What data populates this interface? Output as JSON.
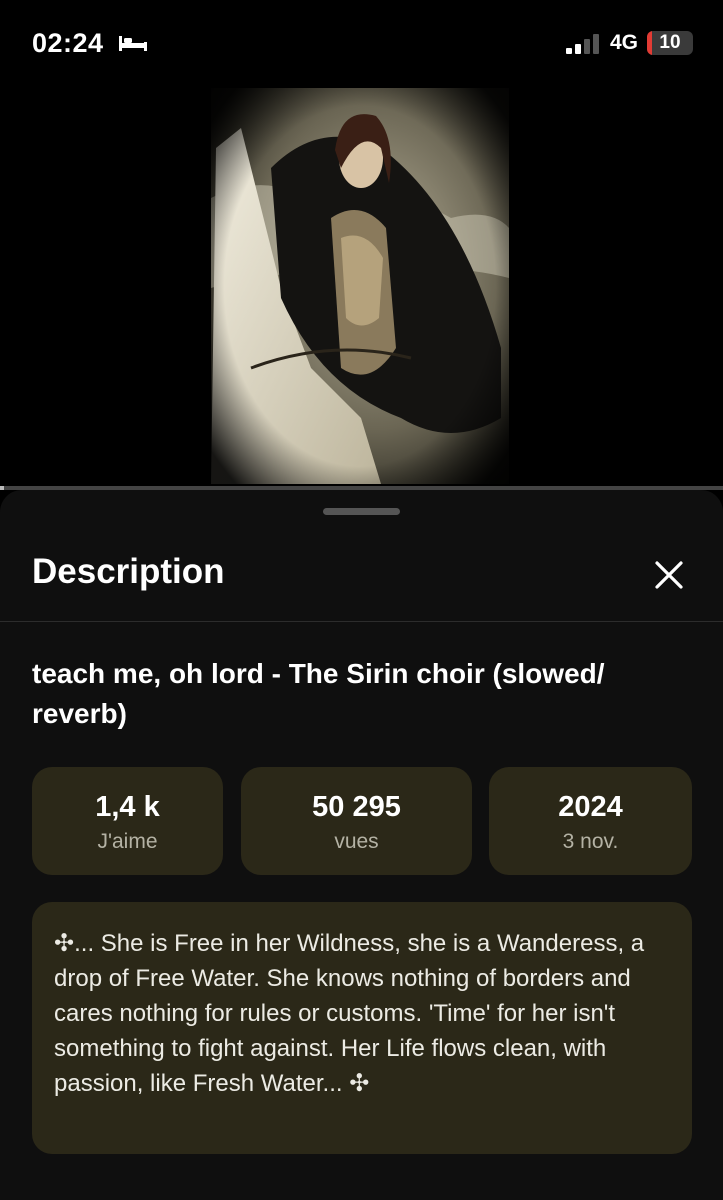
{
  "status_bar": {
    "time": "02:24",
    "network": "4G",
    "battery_level": "10",
    "battery_fraction": 0.1,
    "bed_icon": "bed-icon",
    "signal_icon": "signal-icon",
    "battery_color": "#e23b34"
  },
  "video": {
    "progress_fraction": 0.005
  },
  "sheet": {
    "title": "Description",
    "close_icon": "close-icon",
    "video_title": "teach me, oh lord - The Sirin choir (slowed/ reverb)",
    "stats": [
      {
        "value": "1,4 k",
        "label": "J'aime"
      },
      {
        "value": "50 295",
        "label": "vues"
      },
      {
        "value": "2024",
        "label": "3 nov."
      }
    ],
    "description": "✣... She is Free in her Wildness, she is a Wanderess, a drop of Free Water. She knows nothing of borders and cares nothing for rules or customs. 'Time' for her isn't something to fight against. Her Life flows clean, with passion, like Fresh Water... ✣",
    "card_color": "#2b2818"
  }
}
